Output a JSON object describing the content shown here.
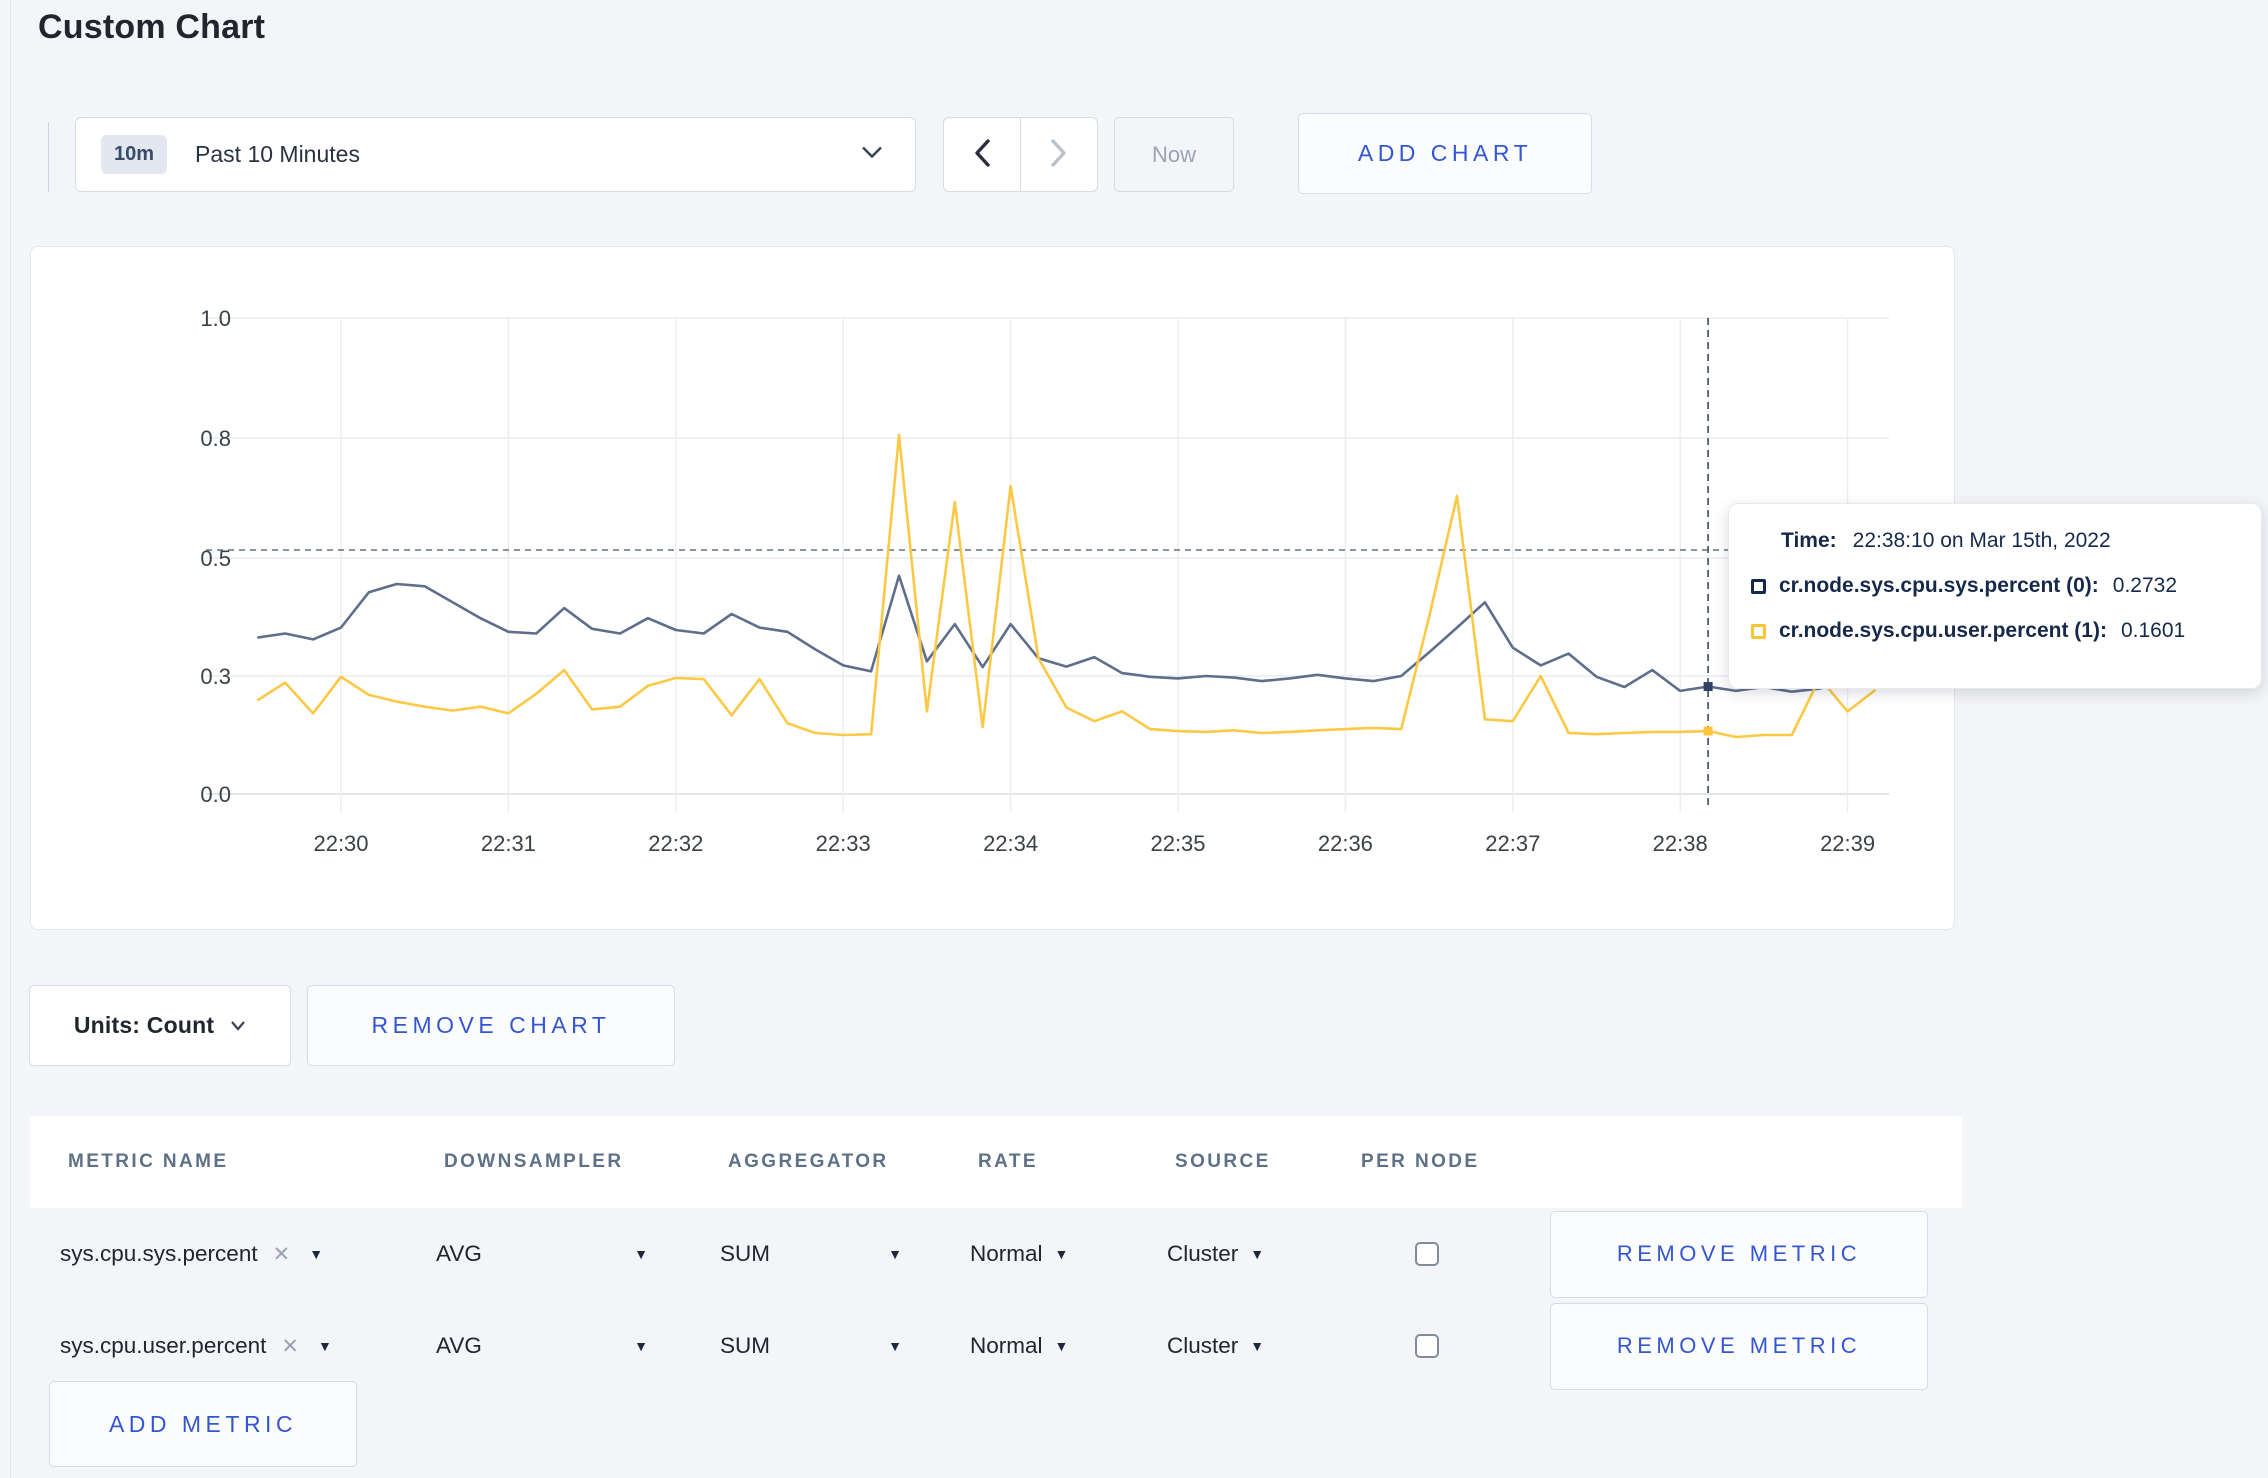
{
  "page": {
    "title": "Custom Chart",
    "background": "#f4f5f8",
    "accent_blue": "#3457d1"
  },
  "toolbar": {
    "time_scale_badge": "10m",
    "time_scale_label": "Past 10 Minutes",
    "now_label": "Now",
    "add_chart_label": "ADD CHART"
  },
  "chart_data": {
    "type": "line",
    "title": "",
    "xlabel": "",
    "ylabel": "",
    "ylim": [
      0,
      1
    ],
    "grid": true,
    "y_ticks": {
      "values": [
        0,
        0.3,
        0.5,
        0.8,
        1.0
      ],
      "labels": [
        "0.0",
        "0.3",
        "0.5",
        "0.8",
        "1.0"
      ]
    },
    "x_ticks": {
      "offsets_seconds": [
        0,
        60,
        120,
        180,
        240,
        300,
        360,
        420,
        480,
        540
      ],
      "labels": [
        "22:30",
        "22:31",
        "22:32",
        "22:33",
        "22:34",
        "22:35",
        "22:36",
        "22:37",
        "22:38",
        "22:39"
      ]
    },
    "start_offset_seconds": -30,
    "sample_interval_seconds": 10,
    "series": [
      {
        "name": "cr.node.sys.cpu.sys.percent (0)",
        "color": "#5f6e8c",
        "values": [
          0.365,
          0.372,
          0.362,
          0.382,
          0.442,
          0.456,
          0.452,
          0.425,
          0.398,
          0.375,
          0.372,
          0.415,
          0.38,
          0.372,
          0.398,
          0.378,
          0.372,
          0.405,
          0.382,
          0.375,
          0.345,
          0.318,
          0.308,
          0.47,
          0.325,
          0.388,
          0.315,
          0.388,
          0.33,
          0.316,
          0.332,
          0.305,
          0.298,
          0.294,
          0.3,
          0.296,
          0.287,
          0.294,
          0.302,
          0.294,
          0.287,
          0.3,
          0.34,
          0.382,
          0.425,
          0.348,
          0.318,
          0.338,
          0.298,
          0.272,
          0.31,
          0.262,
          0.2732,
          0.262,
          0.272,
          0.26,
          0.268,
          0.285,
          0.272
        ]
      },
      {
        "name": "cr.node.sys.cpu.user.percent (1)",
        "color": "#fcc945",
        "values": [
          0.238,
          0.283,
          0.205,
          0.298,
          0.252,
          0.235,
          0.222,
          0.212,
          0.222,
          0.205,
          0.255,
          0.31,
          0.215,
          0.222,
          0.275,
          0.295,
          0.292,
          0.2,
          0.292,
          0.18,
          0.155,
          0.15,
          0.152,
          0.805,
          0.21,
          0.64,
          0.17,
          0.68,
          0.33,
          0.22,
          0.185,
          0.21,
          0.165,
          0.16,
          0.158,
          0.162,
          0.155,
          0.158,
          0.162,
          0.165,
          0.168,
          0.165,
          0.4,
          0.655,
          0.19,
          0.185,
          0.3,
          0.155,
          0.152,
          0.155,
          0.158,
          0.158,
          0.1601,
          0.145,
          0.15,
          0.15,
          0.295,
          0.21,
          0.265
        ]
      }
    ],
    "hover": {
      "time_offset_seconds": 490,
      "crosshair_value": 0.52,
      "dot_colors": [
        "#33415f",
        "#fcc43e"
      ]
    },
    "legend_position": "tooltip"
  },
  "tooltip": {
    "time_label": "Time:",
    "time_value": "22:38:10 on Mar 15th, 2022",
    "rows": [
      {
        "label": "cr.node.sys.cpu.sys.percent (0):",
        "value": "0.2732",
        "color": "#16294b"
      },
      {
        "label": "cr.node.sys.cpu.user.percent (1):",
        "value": "0.1601",
        "color": "#fdc433"
      }
    ]
  },
  "chart_controls": {
    "units_label": "Units: Count",
    "remove_chart_label": "REMOVE CHART"
  },
  "metrics_table": {
    "headers": [
      "METRIC NAME",
      "DOWNSAMPLER",
      "AGGREGATOR",
      "RATE",
      "SOURCE",
      "PER NODE"
    ],
    "rows": [
      {
        "metric_name": "sys.cpu.sys.percent",
        "downsampler": "AVG",
        "aggregator": "SUM",
        "rate": "Normal",
        "source": "Cluster",
        "per_node_checked": false,
        "remove_label": "REMOVE METRIC"
      },
      {
        "metric_name": "sys.cpu.user.percent",
        "downsampler": "AVG",
        "aggregator": "SUM",
        "rate": "Normal",
        "source": "Cluster",
        "per_node_checked": false,
        "remove_label": "REMOVE METRIC"
      }
    ],
    "add_metric_label": "ADD METRIC"
  }
}
